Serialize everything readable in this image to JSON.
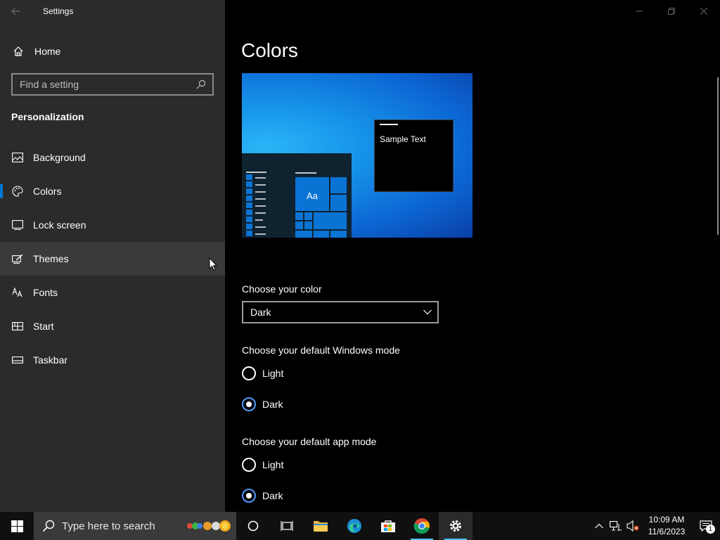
{
  "window": {
    "title": "Settings",
    "back_icon": "back-arrow-icon"
  },
  "sidebar": {
    "home_label": "Home",
    "search_placeholder": "Find a setting",
    "section_header": "Personalization",
    "items": [
      {
        "label": "Background",
        "icon": "picture-icon"
      },
      {
        "label": "Colors",
        "icon": "palette-icon",
        "selected": true
      },
      {
        "label": "Lock screen",
        "icon": "lock-screen-icon"
      },
      {
        "label": "Themes",
        "icon": "themes-icon",
        "hovered": true
      },
      {
        "label": "Fonts",
        "icon": "fonts-icon"
      },
      {
        "label": "Start",
        "icon": "start-icon"
      },
      {
        "label": "Taskbar",
        "icon": "taskbar-icon"
      }
    ]
  },
  "main": {
    "title": "Colors",
    "preview": {
      "sample_text": "Sample Text",
      "tile_text": "Aa"
    },
    "choose_color": {
      "label": "Choose your color",
      "selected": "Dark"
    },
    "windows_mode": {
      "label": "Choose your default Windows mode",
      "options": [
        "Light",
        "Dark"
      ],
      "selected": "Dark"
    },
    "app_mode": {
      "label": "Choose your default app mode",
      "options": [
        "Light",
        "Dark"
      ],
      "selected": "Dark"
    }
  },
  "taskbar": {
    "search_placeholder": "Type here to search",
    "apps": [
      "cortana-icon",
      "task-view-icon",
      "file-explorer-icon",
      "edge-icon",
      "store-icon",
      "chrome-icon",
      "settings-icon"
    ],
    "clock_time": "10:09 AM",
    "clock_date": "11/6/2023",
    "notification_count": "1"
  },
  "colors": {
    "accent": "#0078d7",
    "sidebar_bg": "#2b2b2b",
    "main_bg": "#000000"
  }
}
